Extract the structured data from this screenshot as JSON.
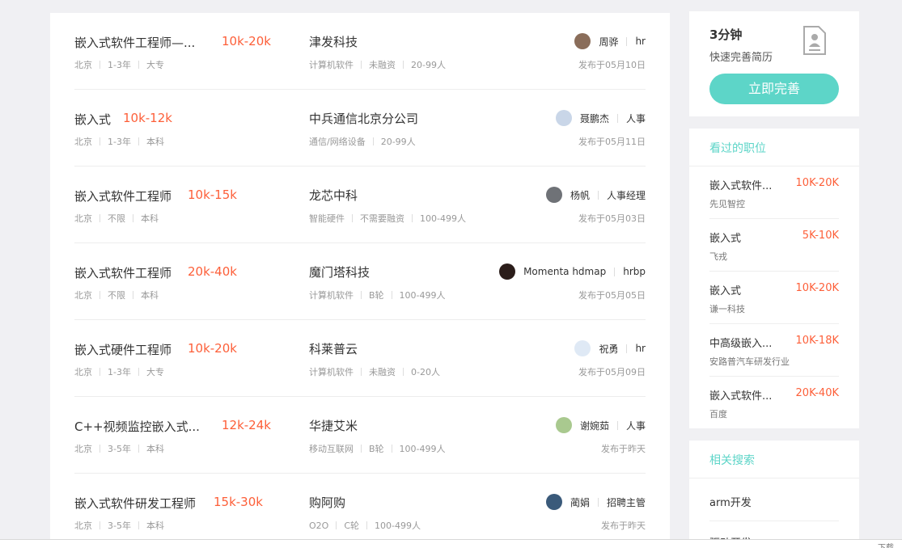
{
  "jobs": [
    {
      "title": "嵌入式软件工程师—...",
      "salary": "10k-20k",
      "city": "北京",
      "exp": "1-3年",
      "edu": "大专",
      "company": "津发科技",
      "industry": "计算机软件",
      "funding": "未融资",
      "size": "20-99人",
      "recruiter": "周骅",
      "role": "hr",
      "posted": "发布于05月10日",
      "avatar_color": "#8a6d5a"
    },
    {
      "title": "嵌入式",
      "salary": "10k-12k",
      "city": "北京",
      "exp": "1-3年",
      "edu": "本科",
      "company": "中兵通信北京分公司",
      "industry": "通信/网络设备",
      "funding": "",
      "size": "20-99人",
      "recruiter": "聂鹏杰",
      "role": "人事",
      "posted": "发布于05月11日",
      "avatar_color": "#c9d6e8"
    },
    {
      "title": "嵌入式软件工程师",
      "salary": "10k-15k",
      "city": "北京",
      "exp": "不限",
      "edu": "本科",
      "company": "龙芯中科",
      "industry": "智能硬件",
      "funding": "不需要融资",
      "size": "100-499人",
      "recruiter": "杨帆",
      "role": "人事经理",
      "posted": "发布于05月03日",
      "avatar_color": "#6f7277"
    },
    {
      "title": "嵌入式软件工程师",
      "salary": "20k-40k",
      "city": "北京",
      "exp": "不限",
      "edu": "本科",
      "company": "魔门塔科技",
      "industry": "计算机软件",
      "funding": "B轮",
      "size": "100-499人",
      "recruiter": "Momenta hdmap",
      "role": "hrbp",
      "posted": "发布于05月05日",
      "avatar_color": "#2b1d1a"
    },
    {
      "title": "嵌入式硬件工程师",
      "salary": "10k-20k",
      "city": "北京",
      "exp": "1-3年",
      "edu": "大专",
      "company": "科莱普云",
      "industry": "计算机软件",
      "funding": "未融资",
      "size": "0-20人",
      "recruiter": "祝勇",
      "role": "hr",
      "posted": "发布于05月09日",
      "avatar_color": "#dfe9f5"
    },
    {
      "title": "C++视频监控嵌入式...",
      "salary": "12k-24k",
      "city": "北京",
      "exp": "3-5年",
      "edu": "本科",
      "company": "华捷艾米",
      "industry": "移动互联网",
      "funding": "B轮",
      "size": "100-499人",
      "recruiter": "谢婉茹",
      "role": "人事",
      "posted": "发布于昨天",
      "avatar_color": "#a9c98f"
    },
    {
      "title": "嵌入式软件研发工程师",
      "salary": "15k-30k",
      "city": "北京",
      "exp": "3-5年",
      "edu": "本科",
      "company": "购阿购",
      "industry": "O2O",
      "funding": "C轮",
      "size": "100-499人",
      "recruiter": "蔺娟",
      "role": "招聘主管",
      "posted": "发布于昨天",
      "avatar_color": "#3a5a7a"
    }
  ],
  "resume": {
    "big": "3分钟",
    "small": "快速完善简历",
    "button": "立即完善"
  },
  "viewed": {
    "heading": "看过的职位",
    "items": [
      {
        "title": "嵌入式软件...",
        "salary": "10K-20K",
        "company": "先见智控"
      },
      {
        "title": "嵌入式",
        "salary": "5K-10K",
        "company": "飞戎"
      },
      {
        "title": "嵌入式",
        "salary": "10K-20K",
        "company": "谦一科技"
      },
      {
        "title": "中高级嵌入...",
        "salary": "10K-18K",
        "company": "安路普汽车研发行业"
      },
      {
        "title": "嵌入式软件...",
        "salary": "20K-40K",
        "company": "百度"
      }
    ]
  },
  "related": {
    "heading": "相关搜索",
    "items": [
      {
        "label": "arm开发"
      },
      {
        "label": "驱动开发"
      }
    ]
  },
  "bottom_bar": {
    "download_label": "下载"
  },
  "colors": {
    "accent": "#5dd5c8",
    "salary": "#fd5f39"
  }
}
